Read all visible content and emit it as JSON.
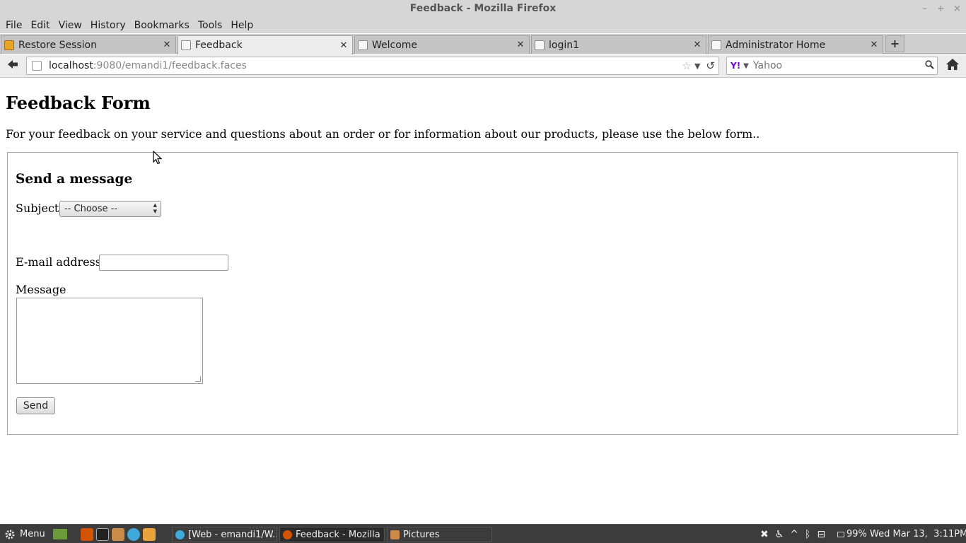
{
  "window": {
    "title": "Feedback - Mozilla Firefox",
    "controls": [
      "–",
      "+",
      "×"
    ]
  },
  "menubar": [
    {
      "label": "File"
    },
    {
      "label": "Edit"
    },
    {
      "label": "View"
    },
    {
      "label": "History"
    },
    {
      "label": "Bookmarks"
    },
    {
      "label": "Tools"
    },
    {
      "label": "Help"
    }
  ],
  "tabs": [
    {
      "label": "Restore Session",
      "active": false
    },
    {
      "label": "Feedback",
      "active": true
    },
    {
      "label": "Welcome",
      "active": false
    },
    {
      "label": "login1",
      "active": false
    },
    {
      "label": "Administrator Home",
      "active": false
    }
  ],
  "navbar": {
    "url_host": "localhost",
    "url_rest": ":9080/emandi1/feedback.faces",
    "search_placeholder": "Yahoo",
    "search_engine": "Y!"
  },
  "page": {
    "heading": "Feedback Form",
    "intro": "For your feedback on your service and questions about an order or for information about our products, please use the below form..",
    "form": {
      "title": "Send a message",
      "subject_label": "Subject",
      "subject_selected": "-- Choose --",
      "email_label": "E-mail address",
      "email_value": "",
      "message_label": "Message",
      "message_value": "",
      "send_label": "Send"
    }
  },
  "taskbar": {
    "menu_label": "Menu",
    "tasks": [
      {
        "label": "[Web - emandi1/W...",
        "active": false
      },
      {
        "label": "Feedback - Mozilla ...",
        "active": true
      },
      {
        "label": "Pictures",
        "active": false
      }
    ],
    "battery": "99%",
    "clock": "Wed Mar 13,  3:11PM"
  }
}
